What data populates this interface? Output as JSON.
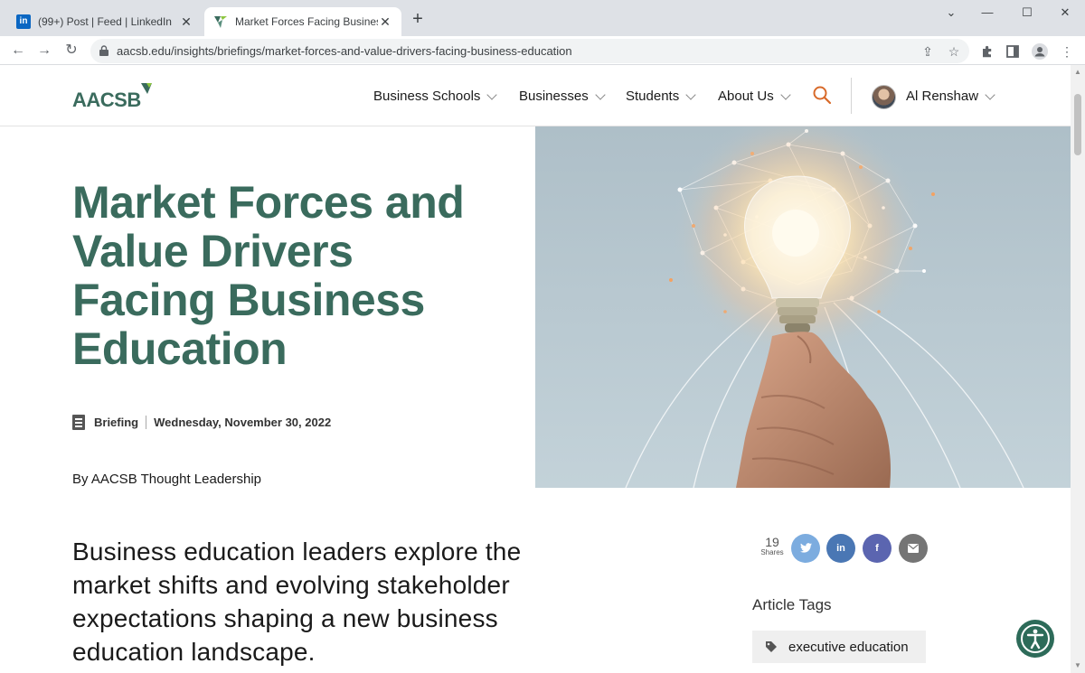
{
  "browser": {
    "tabs": [
      {
        "title": "(99+) Post | Feed | LinkedIn",
        "favicon": "LinkedIn",
        "favicon_text": "in",
        "active": false
      },
      {
        "title": "Market Forces Facing Business Ed",
        "favicon": "AACSB",
        "active": true
      }
    ],
    "close_glyph": "✕",
    "new_tab_glyph": "+",
    "window_controls": {
      "dropdown": "⌄",
      "minimize": "—",
      "maximize": "☐",
      "close": "✕"
    },
    "nav": {
      "back": "←",
      "forward": "→",
      "reload": "↻"
    },
    "url": "aacsb.edu/insights/briefings/market-forces-and-value-drivers-facing-business-education",
    "omnibox_icons": {
      "share": "⇪",
      "bookmark": "☆"
    },
    "toolbar_icons": {
      "extensions": "puzzle-icon",
      "side_panel": "side-panel-icon",
      "profile": "profile-icon",
      "menu": "⋮"
    }
  },
  "site": {
    "logo": "AACSB",
    "nav": [
      "Business Schools",
      "Businesses",
      "Students",
      "About Us"
    ],
    "user": "Al Renshaw"
  },
  "article": {
    "title": "Market Forces and Value Drivers Facing Business Education",
    "type": "Briefing",
    "date": "Wednesday, November 30, 2022",
    "byline": "By AACSB Thought Leadership",
    "lede": "Business education leaders explore the market shifts and evolving stakeholder expectations shaping a new business education landscape."
  },
  "share": {
    "count": "19",
    "label": "Shares",
    "buttons": [
      {
        "name": "twitter",
        "glyph": "🐦",
        "color": "#7cacdf"
      },
      {
        "name": "linkedin",
        "glyph": "in",
        "color": "#4a77b4"
      },
      {
        "name": "facebook",
        "glyph": "f",
        "color": "#5b65b0"
      },
      {
        "name": "email",
        "glyph": "✉",
        "color": "#757575"
      }
    ]
  },
  "tags": {
    "title": "Article Tags",
    "items": [
      "executive education"
    ]
  },
  "colors": {
    "brand_green": "#3a6b5d",
    "search_orange": "#d86a2a",
    "accessibility_green": "#2d6b59"
  }
}
